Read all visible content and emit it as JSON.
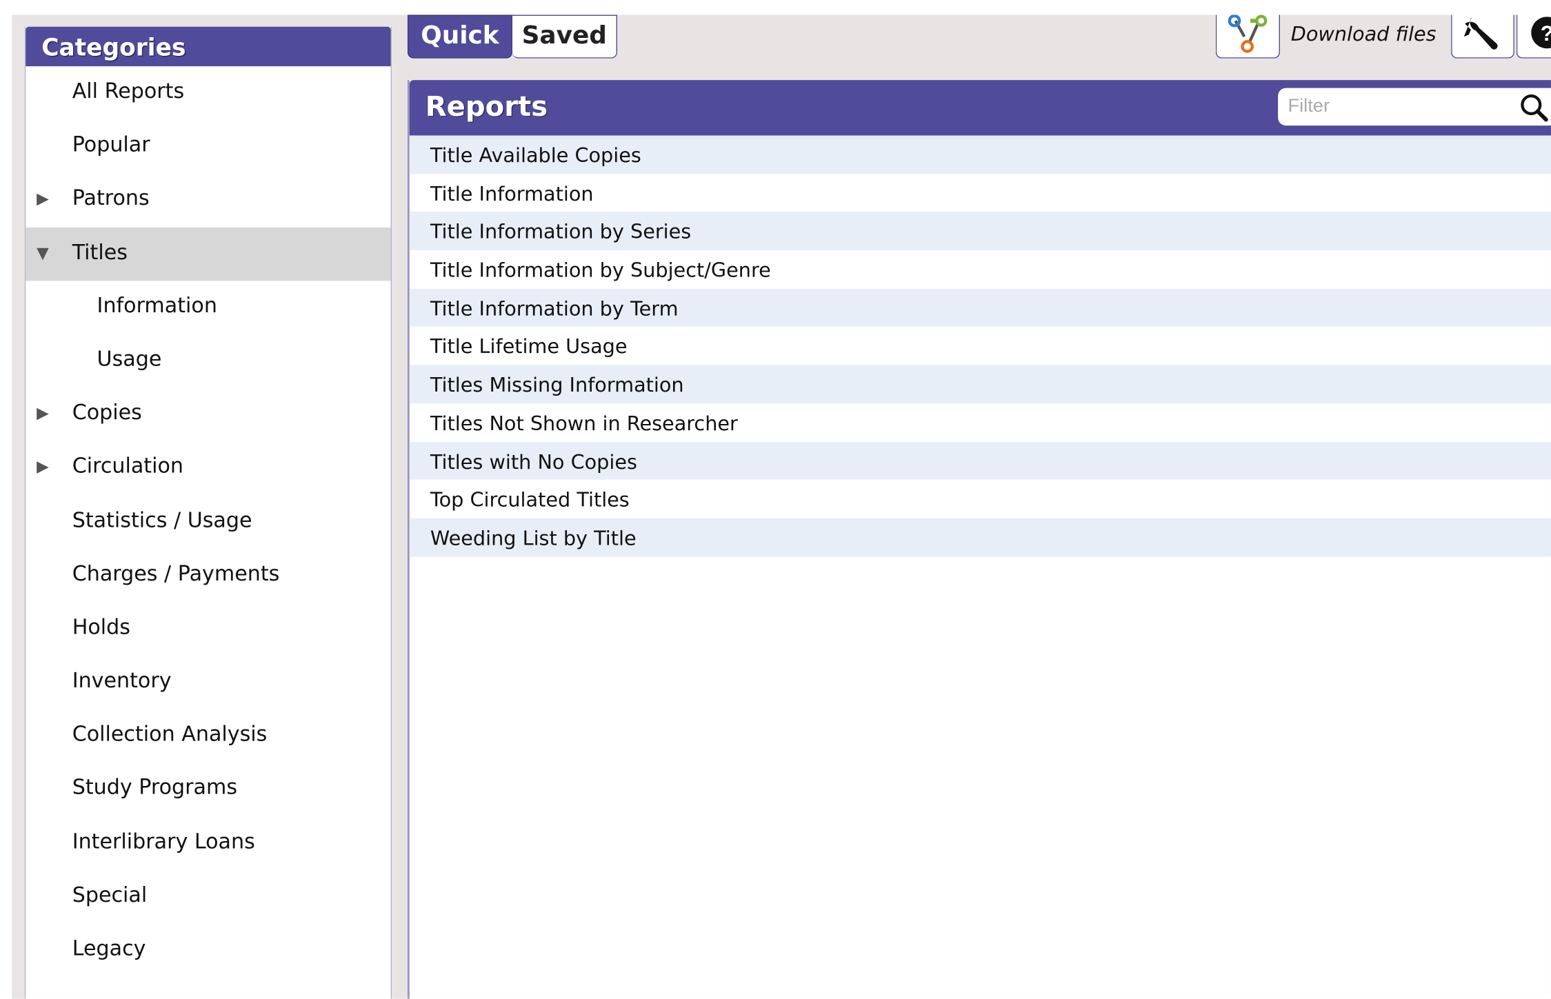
{
  "tabs": [
    {
      "label": "Quick",
      "active": true
    },
    {
      "label": "Saved",
      "active": false
    }
  ],
  "toolbar": {
    "download_label": "Download files",
    "download_icon": "download-files-icon",
    "wrench_icon": "wrench-icon",
    "help_icon": "help-icon"
  },
  "categories": {
    "title": "Categories",
    "items": [
      {
        "label": "All Reports",
        "arrow": "",
        "level": 0
      },
      {
        "label": "Popular",
        "arrow": "",
        "level": 0
      },
      {
        "label": "Patrons",
        "arrow": "▶",
        "level": 0
      },
      {
        "label": "Titles",
        "arrow": "▼",
        "level": 0,
        "selected": true
      },
      {
        "label": "Information",
        "arrow": "",
        "level": 1
      },
      {
        "label": "Usage",
        "arrow": "",
        "level": 1
      },
      {
        "label": "Copies",
        "arrow": "▶",
        "level": 0
      },
      {
        "label": "Circulation",
        "arrow": "▶",
        "level": 0
      },
      {
        "label": "Statistics / Usage",
        "arrow": "",
        "level": 0
      },
      {
        "label": "Charges / Payments",
        "arrow": "",
        "level": 0
      },
      {
        "label": "Holds",
        "arrow": "",
        "level": 0
      },
      {
        "label": "Inventory",
        "arrow": "",
        "level": 0
      },
      {
        "label": "Collection Analysis",
        "arrow": "",
        "level": 0
      },
      {
        "label": "Study Programs",
        "arrow": "",
        "level": 0
      },
      {
        "label": "Interlibrary Loans",
        "arrow": "",
        "level": 0
      },
      {
        "label": "Special",
        "arrow": "",
        "level": 0
      },
      {
        "label": "Legacy",
        "arrow": "",
        "level": 0
      }
    ]
  },
  "reports": {
    "title": "Reports",
    "filter_placeholder": "Filter",
    "filter_value": "",
    "items": [
      "Title Available Copies",
      "Title Information",
      "Title Information by Series",
      "Title Information by Subject/Genre",
      "Title Information by Term",
      "Title Lifetime Usage",
      "Titles Missing Information",
      "Titles Not Shown in Researcher",
      "Titles with No Copies",
      "Top Circulated Titles",
      "Weeding List by Title"
    ]
  },
  "colors": {
    "accent": "#514b9b",
    "row_alt": "#e8eef7",
    "selected": "#d7d7d7"
  }
}
